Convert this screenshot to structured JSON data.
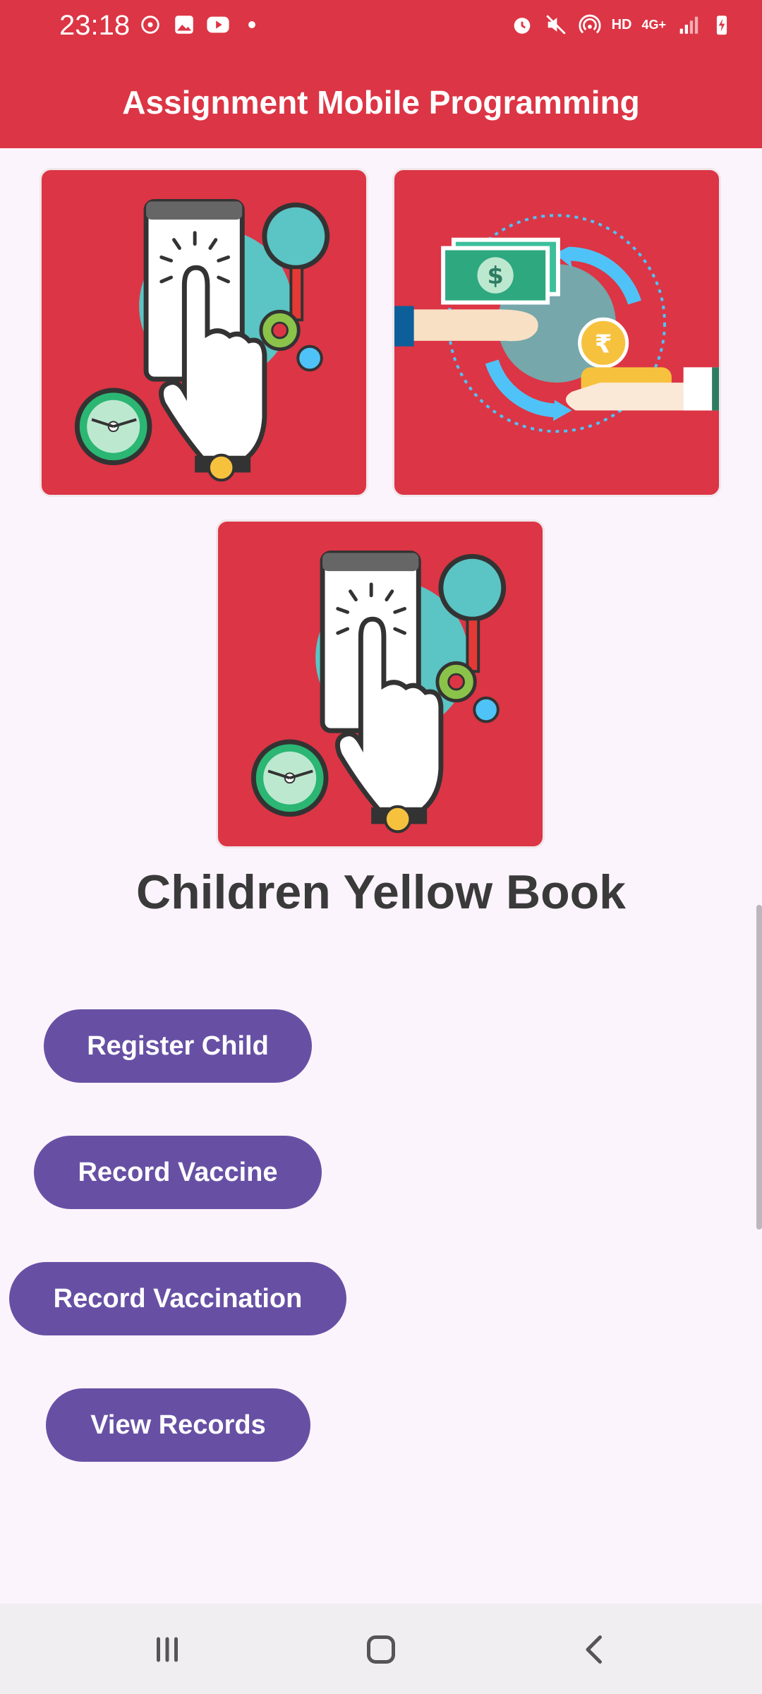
{
  "status_bar": {
    "time": "23:18",
    "left_icons": [
      "sync-icon",
      "gallery-icon",
      "youtube-icon",
      "dot-icon"
    ],
    "right_icons": [
      "alarm-icon",
      "mute-icon",
      "hotspot-icon",
      "hd-icon",
      "4g-icon",
      "signal-icon",
      "battery-charging-icon"
    ],
    "hd_label": "HD",
    "network_label": "4G+"
  },
  "app_bar": {
    "title": "Assignment Mobile Programming",
    "color": "#dc3545"
  },
  "images": [
    {
      "name": "touch-illustration"
    },
    {
      "name": "money-exchange-illustration"
    },
    {
      "name": "touch-illustration"
    }
  ],
  "heading": "Children Yellow Book",
  "buttons": {
    "register_child": "Register Child",
    "record_vaccine": "Record Vaccine",
    "record_vaccination": "Record Vaccination",
    "view_records": "View Records"
  },
  "colors": {
    "accent": "#dc3545",
    "button": "#6750a4",
    "background": "#fcf4fc"
  },
  "nav_bar": {
    "items": [
      "recent-apps-icon",
      "home-icon",
      "back-icon"
    ]
  }
}
